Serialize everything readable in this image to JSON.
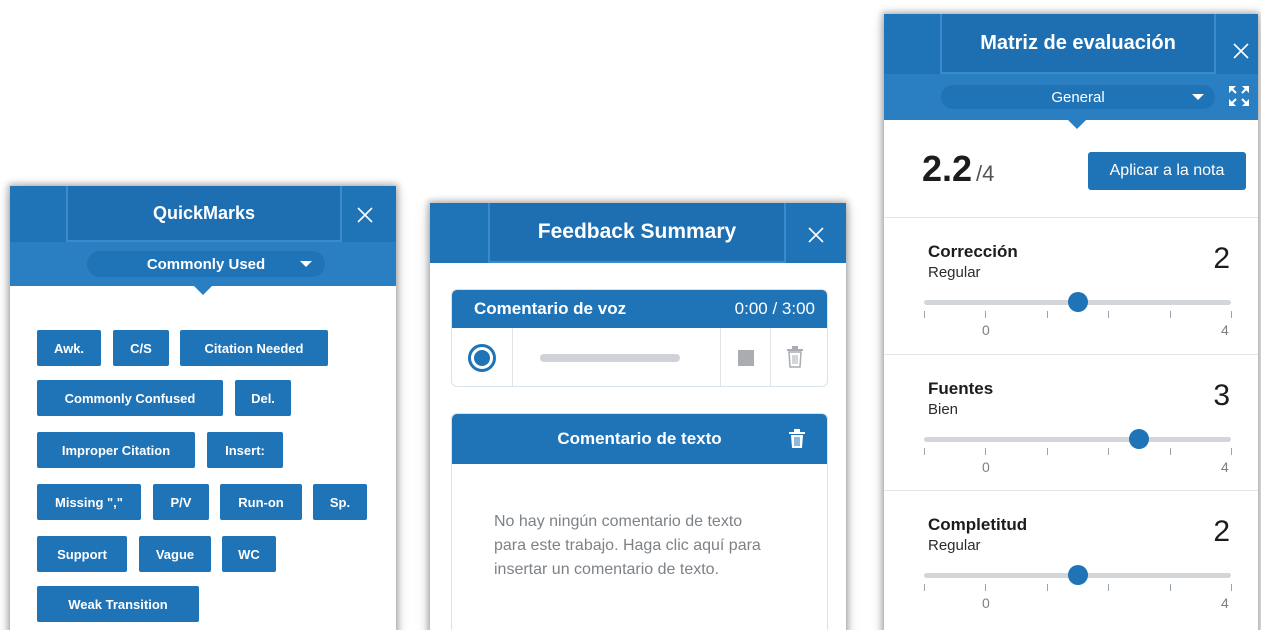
{
  "quickmarks": {
    "title": "QuickMarks",
    "set_selected": "Commonly Used",
    "tags": [
      "Awk.",
      "C/S",
      "Citation Needed",
      "Commonly Confused",
      "Del.",
      "Improper Citation",
      "Insert:",
      "Missing \",\"",
      "P/V",
      "Run-on",
      "Sp.",
      "Support",
      "Vague",
      "WC",
      "Weak Transition"
    ]
  },
  "feedback": {
    "title": "Feedback Summary",
    "voice": {
      "label": "Comentario de voz",
      "time": "0:00 / 3:00"
    },
    "text": {
      "label": "Comentario de texto",
      "empty_message": "No hay ningún comentario de texto para este trabajo. Haga clic aquí para insertar un comentario de texto."
    }
  },
  "rubric": {
    "title": "Matriz de evaluación",
    "view_selected": "General",
    "score": "2.2",
    "score_max": "/4",
    "apply_label": "Aplicar a la nota",
    "criteria": [
      {
        "name": "Corrección",
        "level": "Regular",
        "score": "2",
        "scale_min": "0",
        "scale_max": "4"
      },
      {
        "name": "Fuentes",
        "level": "Bien",
        "score": "3",
        "scale_min": "0",
        "scale_max": "4"
      },
      {
        "name": "Completitud",
        "level": "Regular",
        "score": "2",
        "scale_min": "0",
        "scale_max": "4"
      }
    ]
  },
  "colors": {
    "brand_blue": "#1f73b7",
    "subbar_blue": "#2a7fc3"
  },
  "icons": [
    "close-icon",
    "chevron-down-icon",
    "record-icon",
    "stop-icon",
    "trash-icon",
    "expand-icon"
  ]
}
